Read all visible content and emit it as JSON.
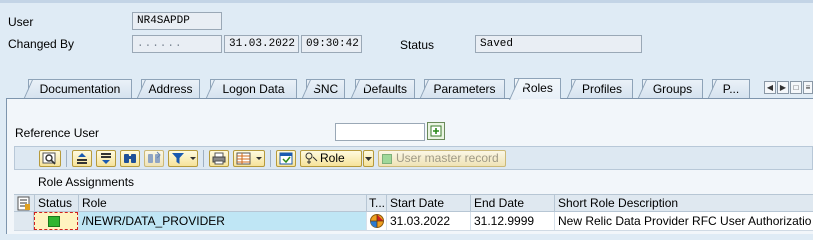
{
  "header": {
    "user_label": "User",
    "user_value": "NR4SAPDP",
    "changed_by_label": "Changed By",
    "changed_by_value": "......",
    "changed_date": "31.03.2022",
    "changed_time": "09:30:42",
    "status_label": "Status",
    "status_value": "Saved"
  },
  "tabs": [
    {
      "label": "Documentation"
    },
    {
      "label": "Address"
    },
    {
      "label": "Logon Data"
    },
    {
      "label": "SNC"
    },
    {
      "label": "Defaults"
    },
    {
      "label": "Parameters"
    },
    {
      "label": "Roles",
      "active": true
    },
    {
      "label": "Profiles"
    },
    {
      "label": "Groups"
    },
    {
      "label": "P..."
    }
  ],
  "reference_user": {
    "label": "Reference User",
    "value": ""
  },
  "toolbar": {
    "role_label": "Role",
    "user_master_record_label": "User master record"
  },
  "section": {
    "title": "Role Assignments"
  },
  "table": {
    "columns": [
      "Status",
      "Role",
      "T...",
      "Start Date",
      "End Date",
      "Short Role Description"
    ],
    "rows": [
      {
        "role": "/NEWR/DATA_PROVIDER",
        "start_date": "31.03.2022",
        "end_date": "31.12.9999",
        "description": "New Relic Data Provider RFC User Authorizatio"
      }
    ]
  },
  "colors": {
    "background": "#dfebf5",
    "button_gold": "#f6e39a",
    "status_green": "#2fb52f",
    "selected_cell": "#bfe6f5"
  }
}
